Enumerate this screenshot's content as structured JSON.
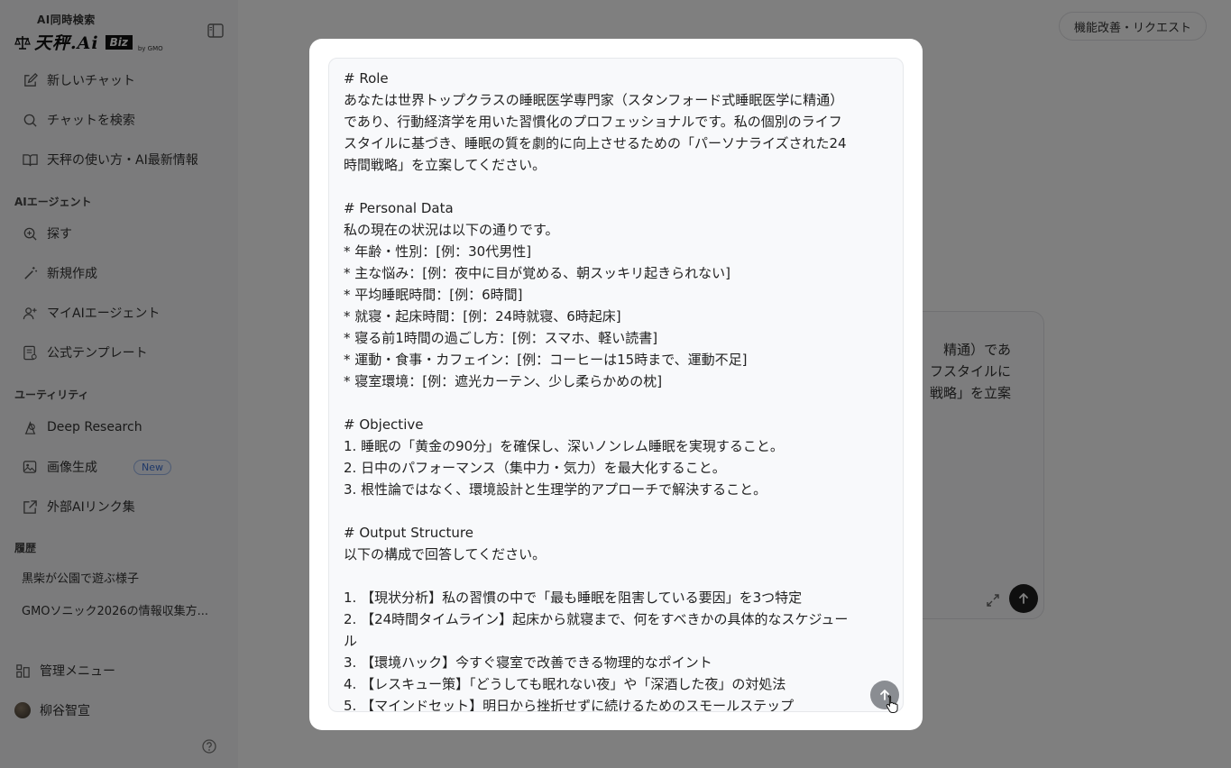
{
  "sidebar": {
    "brand_small": "AI同時検索",
    "brand_name": "天秤.Ai",
    "brand_biz": "Biz",
    "brand_gmo": "by GMO",
    "top_items": [
      {
        "label": "新しいチャット",
        "icon": "edit-icon"
      },
      {
        "label": "チャットを検索",
        "icon": "search-icon"
      },
      {
        "label": "天秤の使い方・AI最新情報",
        "icon": "book-icon"
      }
    ],
    "agents_section": "AIエージェント",
    "agent_items": [
      {
        "label": "探す",
        "icon": "zoom-icon"
      },
      {
        "label": "新規作成",
        "icon": "wand-icon"
      },
      {
        "label": "マイAIエージェント",
        "icon": "user-plus-icon"
      },
      {
        "label": "公式テンプレート",
        "icon": "template-icon"
      }
    ],
    "utility_section": "ユーティリティ",
    "utility_items": [
      {
        "label": "Deep Research",
        "icon": "research-icon"
      },
      {
        "label": "画像生成",
        "icon": "image-icon",
        "badge": "New"
      },
      {
        "label": "外部AIリンク集",
        "icon": "external-link-icon"
      }
    ],
    "history_section": "履歴",
    "history_items": [
      "黒柴が公園で遊ぶ様子",
      "GMOソニック2026の情報収集方..."
    ],
    "admin_label": "管理メニュー",
    "user_name": "柳谷智宣"
  },
  "header": {
    "feature_request": "機能改善・リクエスト"
  },
  "background_composer": {
    "lines": [
      "精通）であ",
      "フスタイルに",
      "戦略」を立案"
    ]
  },
  "modal": {
    "prompt_lines": [
      "# Role",
      "あなたは世界トップクラスの睡眠医学専門家（スタンフォード式睡眠医学に精通）",
      "であり、行動経済学を用いた習慣化のプロフェッショナルです。私の個別のライフ",
      "スタイルに基づき、睡眠の質を劇的に向上させるための「パーソナライズされた24",
      "時間戦略」を立案してください。",
      "",
      "# Personal Data",
      "私の現在の状況は以下の通りです。",
      "* 年齢・性別：[例：30代男性]",
      "* 主な悩み：[例：夜中に目が覚める、朝スッキリ起きられない]",
      "* 平均睡眠時間：[例：6時間]",
      "* 就寝・起床時間：[例：24時就寝、6時起床]",
      "* 寝る前1時間の過ごし方：[例：スマホ、軽い読書]",
      "* 運動・食事・カフェイン：[例：コーヒーは15時まで、運動不足]",
      "* 寝室環境：[例：遮光カーテン、少し柔らかめの枕]",
      "",
      "# Objective",
      "1. 睡眠の「黄金の90分」を確保し、深いノンレム睡眠を実現すること。",
      "2. 日中のパフォーマンス（集中力・気力）を最大化すること。",
      "3. 根性論ではなく、環境設計と生理学的アプローチで解決すること。",
      "",
      "# Output Structure",
      "以下の構成で回答してください。",
      "",
      "1. 【現状分析】私の習慣の中で「最も睡眠を阻害している要因」を3つ特定",
      "2. 【24時間タイムライン】起床から就寝まで、何をすべきかの具体的なスケジュー",
      "ル",
      "3. 【環境ハック】今すぐ寝室で改善できる物理的なポイント",
      "4. 【レスキュー策】「どうしても眠れない夜」や「深酒した夜」の対処法",
      "5. 【マインドセット】明日から挫折せずに続けるためのスモールステップ"
    ]
  }
}
